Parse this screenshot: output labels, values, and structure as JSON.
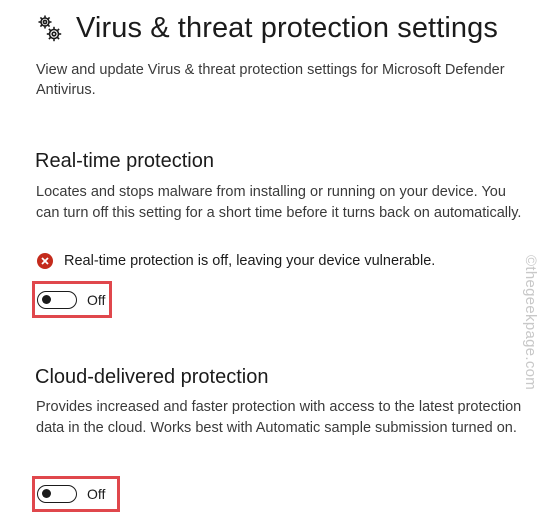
{
  "header": {
    "icon": "gear-icon",
    "title": "Virus & threat protection settings",
    "description": "View and update Virus & threat protection settings for Microsoft Defender Antivirus."
  },
  "realtime": {
    "title": "Real-time protection",
    "description": "Locates and stops malware from installing or running on your device. You can turn off this setting for a short time before it turns back on automatically.",
    "warning_icon": "error-icon",
    "warning_color": "#c42b1c",
    "warning_text": "Real-time protection is off, leaving your device vulnerable.",
    "toggle_state": "Off"
  },
  "cloud": {
    "title": "Cloud-delivered protection",
    "description": "Provides increased and faster protection with access to the latest protection data in the cloud. Works best with Automatic sample submission turned on.",
    "toggle_state": "Off"
  },
  "highlight_color": "#e0474c",
  "watermark": "©thegeekpage.com"
}
